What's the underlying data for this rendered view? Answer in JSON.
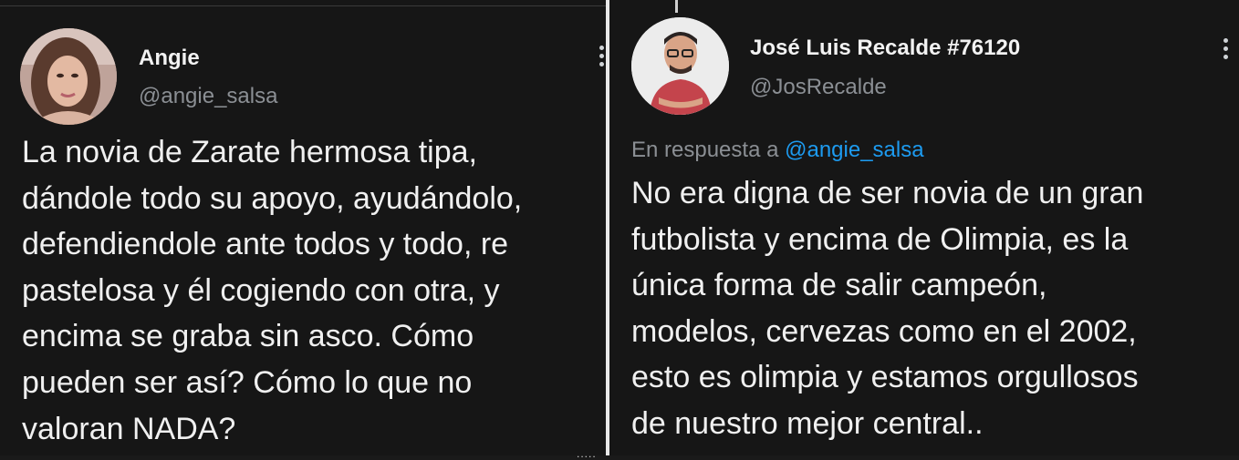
{
  "left_tweet": {
    "author_name": "Angie",
    "author_handle": "@angie_salsa",
    "text_lines": [
      "La novia de Zarate hermosa tipa,",
      "dándole todo su apoyo, ayudándolo,",
      "defendiendole ante todos y todo, re",
      "pastelosa y él cogiendo con otra, y",
      "encima se graba sin asco. Cómo",
      "pueden ser así? Cómo lo que no",
      "valoran NADA?"
    ]
  },
  "right_tweet": {
    "author_name": "José Luis Recalde #76120",
    "author_handle": "@JosRecalde",
    "reply_prefix": "En respuesta a",
    "reply_to": "@angie_salsa",
    "text_lines": [
      "No era digna de ser novia de un gran",
      "futbolista y encima de Olimpia, es la",
      "única forma de salir campeón,",
      "modelos, cervezas como en el 2002,",
      "esto es olimpia y estamos orgullosos",
      "de nuestro mejor central.."
    ]
  },
  "icons": {
    "more_options": "more-vertical-icon",
    "avatar_left": "avatar-photo",
    "avatar_right": "avatar-photo"
  },
  "colors": {
    "background": "#161616",
    "text": "#f0f0f0",
    "muted": "#8b8f94",
    "link": "#1d9bf0"
  }
}
